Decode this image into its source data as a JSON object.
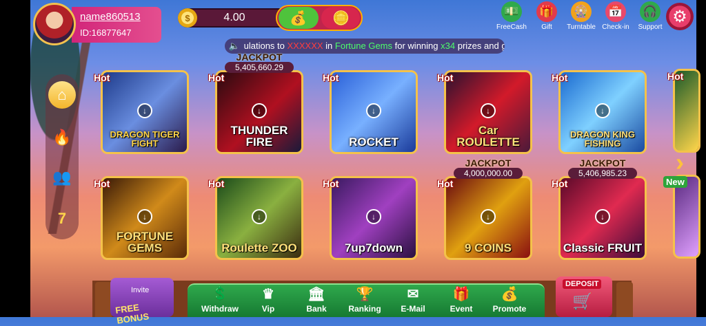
{
  "header": {
    "username": "name860513",
    "user_id": "ID:16877647",
    "balance": "4.00",
    "top_icons": [
      {
        "label": "FreeCash",
        "icon": "freecash-icon",
        "glyph": "💵",
        "color": "#2fa94c"
      },
      {
        "label": "Gift",
        "icon": "gift-icon",
        "glyph": "🎁",
        "color": "#e23b4b"
      },
      {
        "label": "Turntable",
        "icon": "turntable-icon",
        "glyph": "🎡",
        "color": "#f1a21c"
      },
      {
        "label": "Check-in",
        "icon": "check-in-icon",
        "glyph": "📅",
        "color": "#e8496b"
      },
      {
        "label": "Support",
        "icon": "support-icon",
        "glyph": "🎧",
        "color": "#2fa94c"
      }
    ]
  },
  "marquee": {
    "prefix": "ulations to",
    "masked": "XXXXXX",
    "mid": "in",
    "game": "Fortune Gems",
    "mid2": "for winning",
    "multiplier": "x34",
    "suffix": "prizes and got"
  },
  "sidebar": [
    {
      "name": "home",
      "glyph": "⌂"
    },
    {
      "name": "hot",
      "glyph": "🔥"
    },
    {
      "name": "multiplayer",
      "glyph": "👥"
    },
    {
      "name": "slots",
      "glyph": "7"
    }
  ],
  "games": [
    {
      "title": "DRAGON TIGER FIGHT",
      "tag": "Hot",
      "jackpot_label": "",
      "jackpot": "",
      "bg": "linear-gradient(135deg,#1d3a8a,#6a8ee0 50%,#2a1a4a)",
      "color": "#ffd54a"
    },
    {
      "title": "THUNDER FIRE",
      "tag": "Hot",
      "jackpot_label": "JACKPOT",
      "jackpot": "5,405,660.29",
      "bg": "linear-gradient(135deg,#2a0a10,#b01020 55%,#1a1a3a)",
      "color": "#ffffff"
    },
    {
      "title": "ROCKET",
      "tag": "Hot",
      "jackpot_label": "",
      "jackpot": "",
      "bg": "linear-gradient(135deg,#2a60d8,#78b0ff 50%,#1a3a9a)",
      "color": "#ffffff"
    },
    {
      "title": "Car ROULETTE",
      "tag": "Hot",
      "jackpot_label": "",
      "jackpot": "",
      "bg": "linear-gradient(135deg,#2a1230,#d21a2a 50%,#4a1a3a)",
      "color": "#ffe07a"
    },
    {
      "title": "DRAGON KING FISHING",
      "tag": "Hot",
      "jackpot_label": "",
      "jackpot": "",
      "bg": "linear-gradient(135deg,#1a6ad0,#7fd0ff 50%,#1a4aa0)",
      "color": "#ffe07a"
    },
    {
      "title": "FORTUNE GEMS",
      "tag": "Hot",
      "jackpot_label": "",
      "jackpot": "",
      "bg": "linear-gradient(135deg,#3a1a08,#d08a1a 50%,#5a2a08)",
      "color": "#ffe07a"
    },
    {
      "title": "Roulette ZOO",
      "tag": "Hot",
      "jackpot_label": "",
      "jackpot": "",
      "bg": "linear-gradient(135deg,#1a4a1a,#8ab040 50%,#3a2a10)",
      "color": "#ffe07a"
    },
    {
      "title": "7up7down",
      "tag": "Hot",
      "jackpot_label": "",
      "jackpot": "",
      "bg": "linear-gradient(135deg,#3a1a60,#a040c0 50%,#2a1040)",
      "color": "#ffffff"
    },
    {
      "title": "9 COINS",
      "tag": "Hot",
      "jackpot_label": "JACKPOT",
      "jackpot": "4,000,000.00",
      "bg": "linear-gradient(135deg,#6a0a10,#e0a010 50%,#8a1010)",
      "color": "#ffe07a"
    },
    {
      "title": "Classic FRUIT",
      "tag": "Hot",
      "jackpot_label": "JACKPOT",
      "jackpot": "5,406,985.23",
      "bg": "linear-gradient(135deg,#5a0a2a,#e02a50 50%,#3a0a3a)",
      "color": "#ffffff"
    }
  ],
  "bottom_nav": {
    "invite_top": "Invite",
    "invite_bonus": "FREE BONUS",
    "deposit": "DEPOSIT",
    "items": [
      {
        "label": "Withdraw",
        "icon": "withdraw-icon",
        "glyph": "💲"
      },
      {
        "label": "Vip",
        "icon": "vip-icon",
        "glyph": "♛"
      },
      {
        "label": "Bank",
        "icon": "bank-icon",
        "glyph": "🏛"
      },
      {
        "label": "Ranking",
        "icon": "ranking-icon",
        "glyph": "🏆"
      },
      {
        "label": "E-Mail",
        "icon": "email-icon",
        "glyph": "✉"
      },
      {
        "label": "Event",
        "icon": "event-icon",
        "glyph": "🎁"
      },
      {
        "label": "Promote",
        "icon": "promote-icon",
        "glyph": "💰"
      }
    ]
  }
}
